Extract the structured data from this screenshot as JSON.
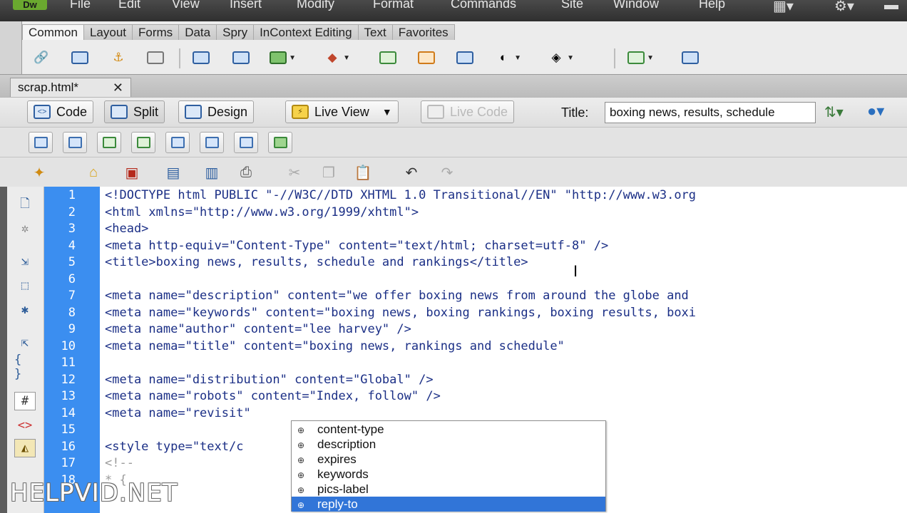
{
  "app": {
    "logo": "Dw"
  },
  "menu": [
    "File",
    "Edit",
    "View",
    "Insert",
    "Modify",
    "Format",
    "Commands",
    "Site",
    "Window",
    "Help"
  ],
  "insert_tabs": [
    "Common",
    "Layout",
    "Forms",
    "Data",
    "Spry",
    "InContext Editing",
    "Text",
    "Favorites"
  ],
  "document": {
    "tab_name": "scrap.html*"
  },
  "view_buttons": {
    "code": "Code",
    "split": "Split",
    "design": "Design",
    "live_view": "Live View",
    "live_code": "Live Code"
  },
  "title": {
    "label": "Title:",
    "value": "boxing news, results, schedule"
  },
  "code": [
    {
      "n": "1",
      "text": "<!DOCTYPE html PUBLIC \"-//W3C//DTD XHTML 1.0 Transitional//EN\" \"http://www.w3.org"
    },
    {
      "n": "2",
      "text": "<html xmlns=\"http://www.w3.org/1999/xhtml\">"
    },
    {
      "n": "3",
      "text": "<head>"
    },
    {
      "n": "4",
      "text": "<meta http-equiv=\"Content-Type\" content=\"text/html; charset=utf-8\" />"
    },
    {
      "n": "5",
      "text": "<title>boxing news, results, schedule and rankings</title>"
    },
    {
      "n": "6",
      "text": ""
    },
    {
      "n": "7",
      "text": "<meta name=\"description\" content=\"we offer boxing news from around the globe and"
    },
    {
      "n": "8",
      "text": "<meta name=\"keywords\" content=\"boxing news, boxing rankings, boxing results, boxi"
    },
    {
      "n": "9",
      "text": "<meta name\"author\" content=\"lee harvey\" />"
    },
    {
      "n": "10",
      "text": "<meta nema=\"title\" content=\"boxing news, rankings and schedule\""
    },
    {
      "n": "11",
      "text": ""
    },
    {
      "n": "12",
      "text": "<meta name=\"distribution\" content=\"Global\" />"
    },
    {
      "n": "13",
      "text": "<meta name=\"robots\" content=\"Index, follow\" />"
    },
    {
      "n": "14",
      "text": "<meta name=\"revisit\""
    },
    {
      "n": "15",
      "text": ""
    },
    {
      "n": "16",
      "text": "<style type=\"text/c"
    },
    {
      "n": "17",
      "text": "<!--"
    },
    {
      "n": "18",
      "text": "* {"
    }
  ],
  "autocomplete": [
    "content-type",
    "description",
    "expires",
    "keywords",
    "pics-label",
    "reply-to"
  ],
  "watermark": "HELPVID.NET",
  "colors": {
    "gutter": "#3b8ef0",
    "code_text": "#1b2f86",
    "selection": "#3175d8",
    "menubar": "#3a3a3a"
  }
}
